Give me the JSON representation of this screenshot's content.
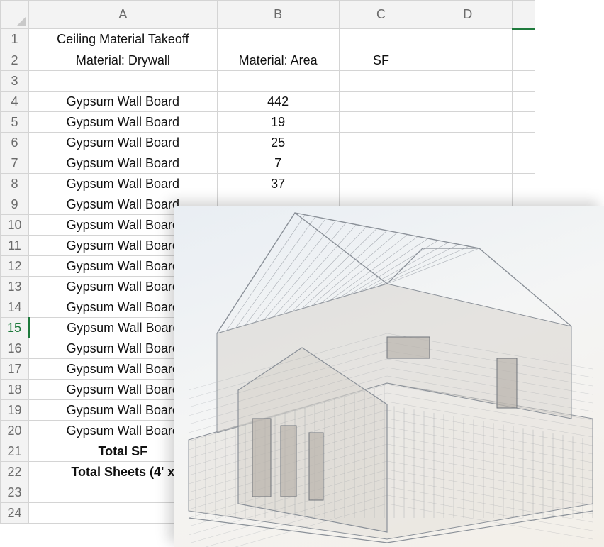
{
  "spreadsheet": {
    "columns": [
      "A",
      "B",
      "C",
      "D",
      ""
    ],
    "rows": [
      {
        "num": "1",
        "a": "Ceiling Material Takeoff",
        "b": "",
        "c": ""
      },
      {
        "num": "2",
        "a": "Material: Drywall",
        "b": "Material: Area",
        "c": "SF"
      },
      {
        "num": "3",
        "a": "",
        "b": "",
        "c": ""
      },
      {
        "num": "4",
        "a": "Gypsum Wall Board",
        "b": "442",
        "c": ""
      },
      {
        "num": "5",
        "a": "Gypsum Wall Board",
        "b": "19",
        "c": ""
      },
      {
        "num": "6",
        "a": "Gypsum Wall Board",
        "b": "25",
        "c": ""
      },
      {
        "num": "7",
        "a": "Gypsum Wall Board",
        "b": "7",
        "c": ""
      },
      {
        "num": "8",
        "a": "Gypsum Wall Board",
        "b": "37",
        "c": ""
      },
      {
        "num": "9",
        "a": "Gypsum Wall Board",
        "b": "",
        "c": ""
      },
      {
        "num": "10",
        "a": "Gypsum Wall Board",
        "b": "",
        "c": ""
      },
      {
        "num": "11",
        "a": "Gypsum Wall Board",
        "b": "",
        "c": ""
      },
      {
        "num": "12",
        "a": "Gypsum Wall Board",
        "b": "",
        "c": ""
      },
      {
        "num": "13",
        "a": "Gypsum Wall Board",
        "b": "",
        "c": ""
      },
      {
        "num": "14",
        "a": "Gypsum Wall Board",
        "b": "",
        "c": ""
      },
      {
        "num": "15",
        "a": "Gypsum Wall Board",
        "b": "",
        "c": ""
      },
      {
        "num": "16",
        "a": "Gypsum Wall Board",
        "b": "",
        "c": ""
      },
      {
        "num": "17",
        "a": "Gypsum Wall Board",
        "b": "",
        "c": ""
      },
      {
        "num": "18",
        "a": "Gypsum Wall Board",
        "b": "",
        "c": ""
      },
      {
        "num": "19",
        "a": "Gypsum Wall Board",
        "b": "",
        "c": ""
      },
      {
        "num": "20",
        "a": "Gypsum Wall Board",
        "b": "",
        "c": ""
      },
      {
        "num": "21",
        "a": "Total SF",
        "b": "",
        "c": ""
      },
      {
        "num": "22",
        "a": "Total Sheets (4' x",
        "b": "",
        "c": ""
      },
      {
        "num": "23",
        "a": "",
        "b": "",
        "c": ""
      },
      {
        "num": "24",
        "a": "",
        "b": "",
        "c": ""
      }
    ],
    "selected_row": "15",
    "bold_rows": [
      "21",
      "22"
    ]
  },
  "colors": {
    "accent": "#1e7a3c",
    "header_bg": "#f3f3f3",
    "grid_line": "#d4d4d4"
  },
  "overlay": {
    "icon": "house-framing-wireframe-icon"
  }
}
